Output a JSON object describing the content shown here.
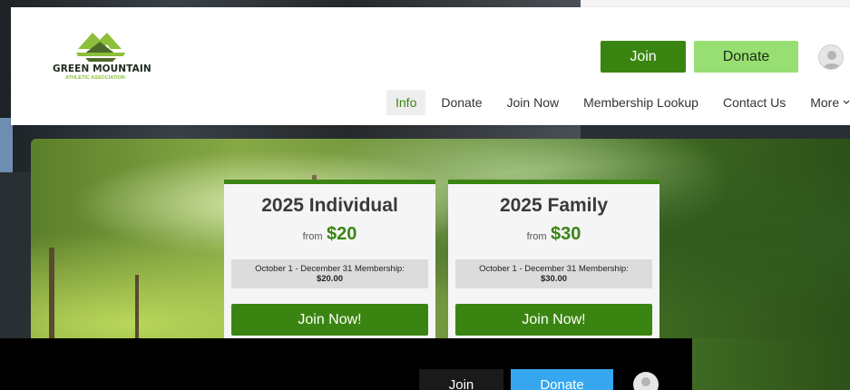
{
  "brand": {
    "name": "GREEN MOUNTAIN",
    "subtitle": "ATHLETIC ASSOCIATION"
  },
  "header": {
    "join_label": "Join",
    "donate_label": "Donate"
  },
  "nav": {
    "items": [
      {
        "label": "Info",
        "active": true
      },
      {
        "label": "Donate"
      },
      {
        "label": "Join Now"
      },
      {
        "label": "Membership Lookup"
      },
      {
        "label": "Contact Us"
      },
      {
        "label": "More"
      }
    ]
  },
  "cards": [
    {
      "title": "2025 Individual",
      "from": "from",
      "price": "$20",
      "period": "October 1 - December 31 Membership:",
      "amount": "$20.00",
      "button": "Join Now!"
    },
    {
      "title": "2025 Family",
      "from": "from",
      "price": "$30",
      "period": "October 1 - December 31 Membership:",
      "amount": "$30.00",
      "button": "Join Now!"
    }
  ],
  "sticky": {
    "join_label": "Join",
    "donate_label": "Donate"
  },
  "colors": {
    "brand_green": "#3a8512",
    "light_green": "#97df72",
    "sticky_donate": "#36a7ef"
  },
  "icons": {
    "avatar": "user-avatar-icon",
    "more": "chevron-down-icon"
  }
}
